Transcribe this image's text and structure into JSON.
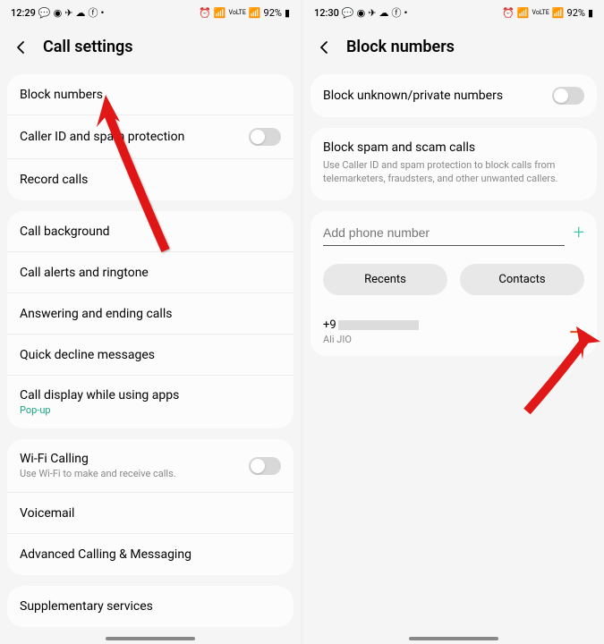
{
  "left": {
    "status": {
      "time": "12:29",
      "battery": "92%"
    },
    "header": "Call settings",
    "sections": [
      {
        "rows": [
          {
            "label": "Block numbers",
            "toggle": false
          },
          {
            "label": "Caller ID and spam protection",
            "toggle": true
          },
          {
            "label": "Record calls",
            "toggle": false
          }
        ]
      },
      {
        "rows": [
          {
            "label": "Call background",
            "toggle": false
          },
          {
            "label": "Call alerts and ringtone",
            "toggle": false
          },
          {
            "label": "Answering and ending calls",
            "toggle": false
          },
          {
            "label": "Quick decline messages",
            "toggle": false
          },
          {
            "label": "Call display while using apps",
            "sub": "Pop-up",
            "subTeal": true,
            "toggle": false
          }
        ]
      },
      {
        "rows": [
          {
            "label": "Wi-Fi Calling",
            "sub": "Use Wi-Fi to make and receive calls.",
            "toggle": true
          },
          {
            "label": "Voicemail",
            "toggle": false
          },
          {
            "label": "Advanced Calling & Messaging",
            "toggle": false
          }
        ]
      },
      {
        "rows": [
          {
            "label": "Supplementary services",
            "toggle": false
          }
        ]
      }
    ]
  },
  "right": {
    "status": {
      "time": "12:30",
      "battery": "92%"
    },
    "header": "Block numbers",
    "blockUnknown": "Block unknown/private numbers",
    "blockSpamTitle": "Block spam and scam calls",
    "blockSpamDesc": "Use Caller ID and spam protection to block calls from telemarketers, fraudsters, and other unwanted callers.",
    "inputPlaceholder": "Add phone number",
    "recents": "Recents",
    "contacts": "Contacts",
    "blocked": {
      "number": "+9",
      "name": "Ali JIO"
    }
  }
}
